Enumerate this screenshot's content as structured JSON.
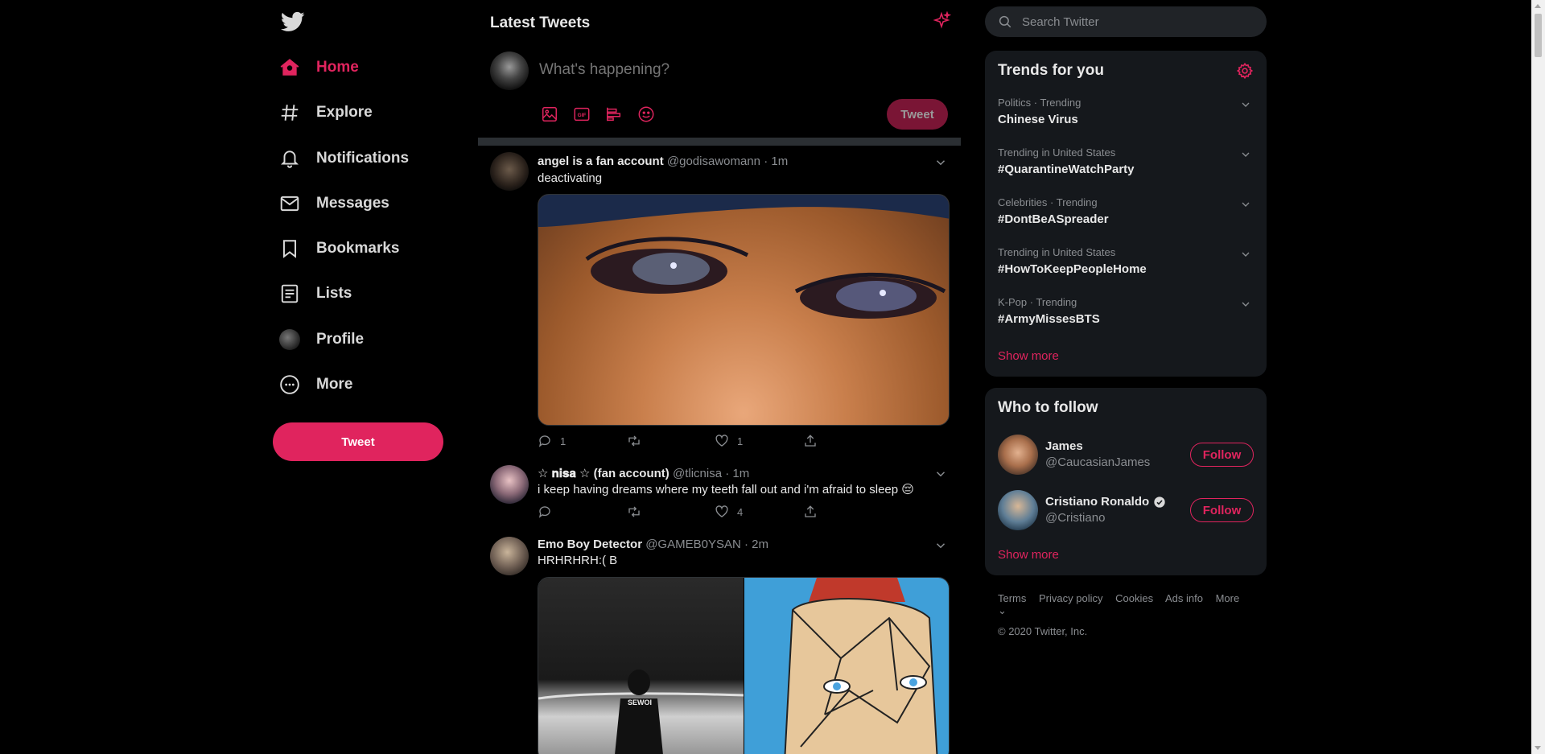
{
  "colors": {
    "accent": "#e0245e",
    "background": "#000000",
    "panel": "#15181c",
    "muted": "#8a8d91"
  },
  "nav": {
    "items": [
      {
        "label": "Home",
        "icon": "home-icon",
        "active": true
      },
      {
        "label": "Explore",
        "icon": "hashtag-icon"
      },
      {
        "label": "Notifications",
        "icon": "bell-icon"
      },
      {
        "label": "Messages",
        "icon": "envelope-icon"
      },
      {
        "label": "Bookmarks",
        "icon": "bookmark-icon"
      },
      {
        "label": "Lists",
        "icon": "list-icon"
      },
      {
        "label": "Profile",
        "icon": "avatar-icon"
      },
      {
        "label": "More",
        "icon": "more-circle-icon"
      }
    ],
    "tweet_button": "Tweet"
  },
  "main": {
    "title": "Latest Tweets",
    "compose": {
      "placeholder": "What's happening?",
      "tweet_button": "Tweet"
    },
    "tweets": [
      {
        "name": "angel is a fan account",
        "handle": "@godisawomann",
        "time": "1m",
        "text": "deactivating",
        "replies": "1",
        "retweets": "",
        "likes": "1"
      },
      {
        "name": "☆ 𝐧𝐢𝐬𝐚 ☆ (fan account)",
        "handle": "@tlicnisa",
        "time": "1m",
        "text": "i keep having dreams where my teeth fall out and i'm afraid to sleep 😔",
        "replies": "",
        "retweets": "",
        "likes": "4"
      },
      {
        "name": "Emo Boy Detector",
        "handle": "@GAMEB0YSAN",
        "time": "2m",
        "text": "HRHRHRH:( B",
        "image_text": "SEWOI"
      }
    ]
  },
  "search": {
    "placeholder": "Search Twitter"
  },
  "trends": {
    "title": "Trends for you",
    "items": [
      {
        "meta": "Politics · Trending",
        "name": "Chinese Virus"
      },
      {
        "meta": "Trending in United States",
        "name": "#QuarantineWatchParty"
      },
      {
        "meta": "Celebrities · Trending",
        "name": "#DontBeASpreader"
      },
      {
        "meta": "Trending in United States",
        "name": "#HowToKeepPeopleHome"
      },
      {
        "meta": "K-Pop · Trending",
        "name": "#ArmyMissesBTS"
      }
    ],
    "show_more": "Show more"
  },
  "who_to_follow": {
    "title": "Who to follow",
    "users": [
      {
        "name": "James",
        "handle": "@CaucasianJames",
        "verified": false,
        "button": "Follow"
      },
      {
        "name": "Cristiano Ronaldo",
        "handle": "@Cristiano",
        "verified": true,
        "button": "Follow"
      }
    ],
    "show_more": "Show more"
  },
  "footer": {
    "links": [
      "Terms",
      "Privacy policy",
      "Cookies",
      "Ads info",
      "More"
    ],
    "copyright": "© 2020 Twitter, Inc."
  }
}
